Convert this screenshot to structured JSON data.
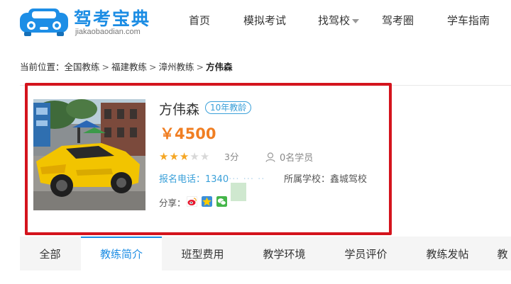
{
  "header": {
    "logo_title": "驾考宝典",
    "logo_subtitle": "jiakaobaodian.com",
    "nav": [
      {
        "label": "首页"
      },
      {
        "label": "模拟考试"
      },
      {
        "label": "找驾校"
      },
      {
        "label": "驾考圈"
      },
      {
        "label": "学车指南"
      }
    ]
  },
  "breadcrumb": {
    "prefix": "当前位置：",
    "items": [
      "全国教练",
      "福建教练",
      "漳州教练"
    ],
    "separator": ">",
    "current": "方伟森"
  },
  "coach": {
    "name": "方伟森",
    "experience_badge": "10年教龄",
    "price": "￥4500",
    "rating_stars": 3,
    "rating_max": 5,
    "score_text": "3分",
    "students_text": "0名学员",
    "phone_label": "报名电话：",
    "phone_number": "1340",
    "phone_masked": "··· ···  ··",
    "school_label": "所属学校：",
    "school_name": "鑫城驾校",
    "share_label": "分享："
  },
  "share_icons": [
    "weibo-icon",
    "qzone-icon",
    "wechat-icon"
  ],
  "tabs": [
    {
      "label": "全部",
      "active": false
    },
    {
      "label": "教练简介",
      "active": true
    },
    {
      "label": "班型费用",
      "active": false
    },
    {
      "label": "教学环境",
      "active": false
    },
    {
      "label": "学员评价",
      "active": false
    },
    {
      "label": "教练发帖",
      "active": false
    },
    {
      "label": "教",
      "active": false
    }
  ],
  "colors": {
    "brand_blue": "#1c8de4",
    "price_orange": "#f07e22",
    "highlight_red": "#d4141d",
    "star_gold": "#f5a623",
    "link_blue": "#3aa0d9"
  }
}
